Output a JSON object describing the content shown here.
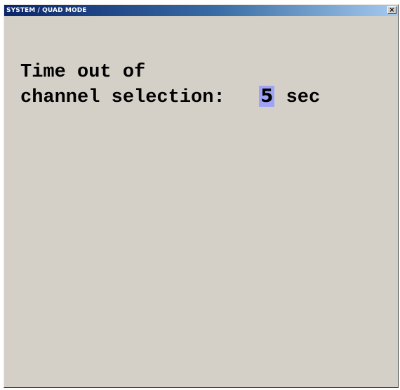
{
  "window": {
    "title": "SYSTEM / QUAD MODE",
    "close_label": "×"
  },
  "setting": {
    "label_line1": "Time out of",
    "label_line2": "channel selection:",
    "value": "5",
    "unit": "sec"
  },
  "colors": {
    "window_background": "#d4d0c8",
    "titlebar_start": "#0a246a",
    "titlebar_end": "#a6caf0",
    "value_highlight": "#9ea3f7"
  },
  "icons": {
    "close": "close-icon"
  }
}
